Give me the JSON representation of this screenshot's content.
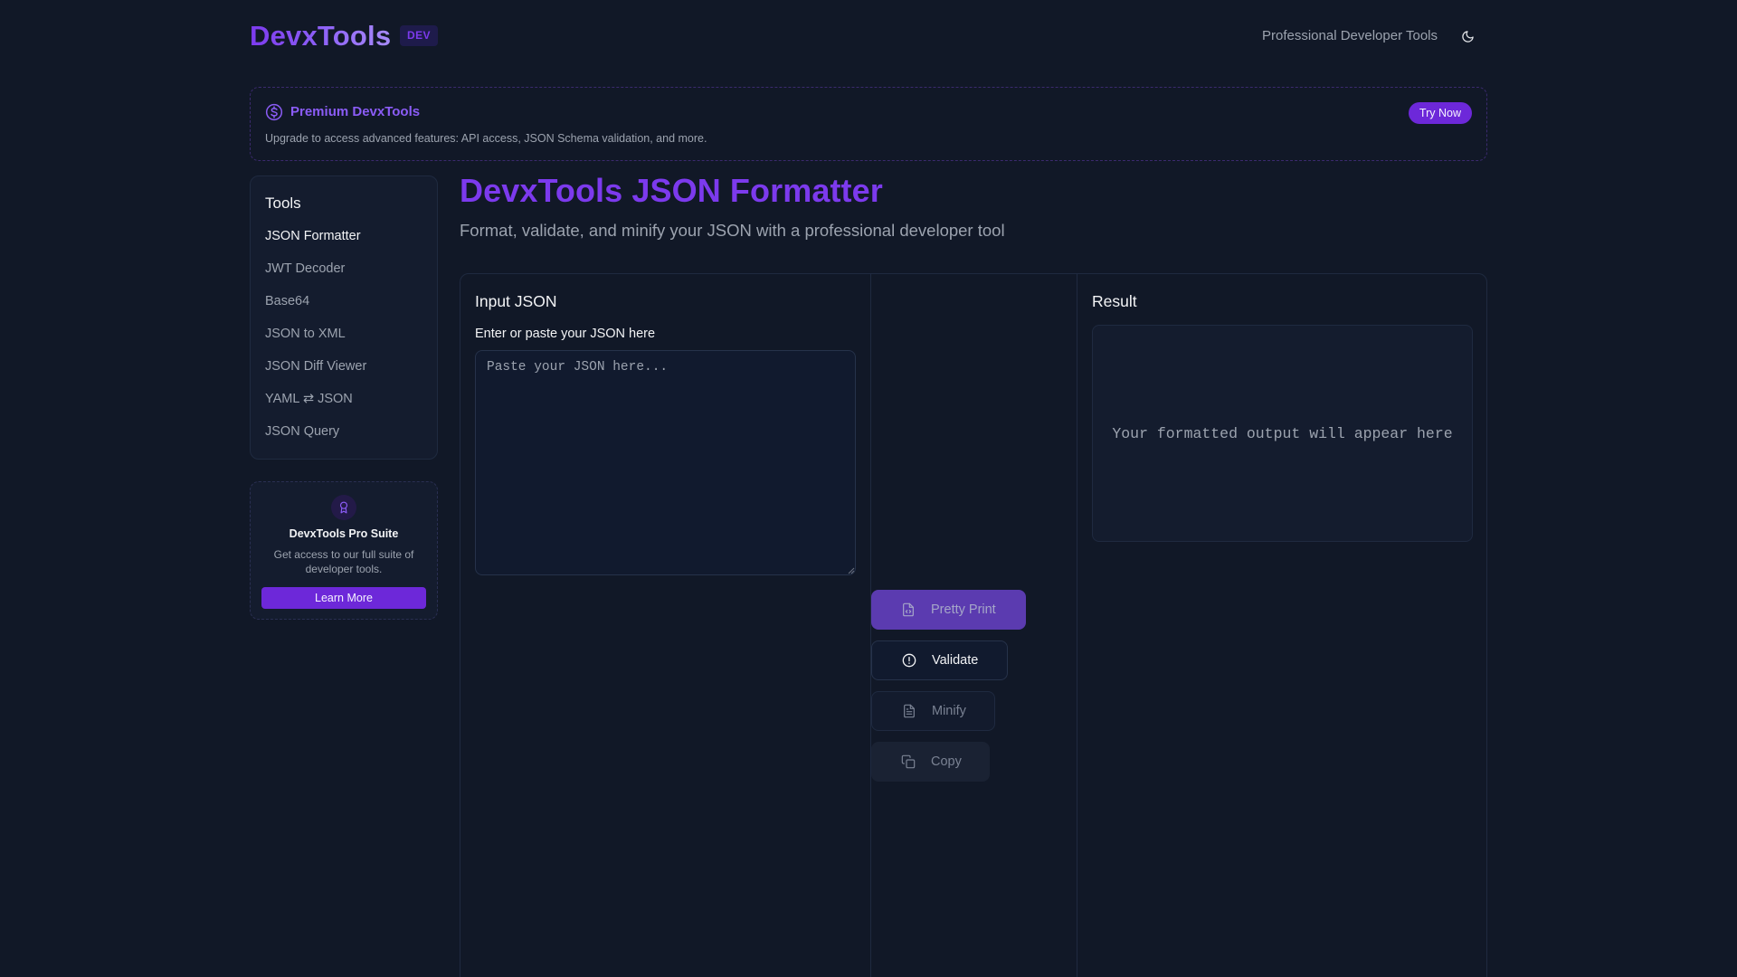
{
  "header": {
    "logo": "DevxTools",
    "badge": "DEV",
    "tagline": "Professional Developer Tools",
    "theme_icon": "moon-icon"
  },
  "banner": {
    "icon": "dollar-circle-icon",
    "title": "Premium DevxTools",
    "description": "Upgrade to access advanced features: API access, JSON Schema validation, and more.",
    "cta": "Try Now"
  },
  "sidebar": {
    "title": "Tools",
    "items": [
      {
        "label": "JSON Formatter",
        "active": true
      },
      {
        "label": "JWT Decoder",
        "active": false
      },
      {
        "label": "Base64",
        "active": false
      },
      {
        "label": "JSON to XML",
        "active": false
      },
      {
        "label": "JSON Diff Viewer",
        "active": false
      },
      {
        "label": "YAML ⇄ JSON",
        "active": false
      },
      {
        "label": "JSON Query",
        "active": false
      }
    ]
  },
  "pro_card": {
    "icon": "award-icon",
    "title": "DevxTools Pro Suite",
    "description": "Get access to our full suite of developer tools.",
    "cta": "Learn More"
  },
  "main": {
    "title": "DevxTools JSON Formatter",
    "subtitle": "Format, validate, and minify your JSON with a professional developer tool"
  },
  "input_panel": {
    "title": "Input JSON",
    "label": "Enter or paste your JSON here",
    "placeholder": "Paste your JSON here...",
    "value": ""
  },
  "actions": {
    "pretty_print": "Pretty Print",
    "validate": "Validate",
    "minify": "Minify",
    "copy": "Copy"
  },
  "result_panel": {
    "title": "Result",
    "placeholder": "Your formatted output will appear here"
  },
  "colors": {
    "background": "#111827",
    "accent": "#7c3aed",
    "panel": "#141c2e"
  }
}
